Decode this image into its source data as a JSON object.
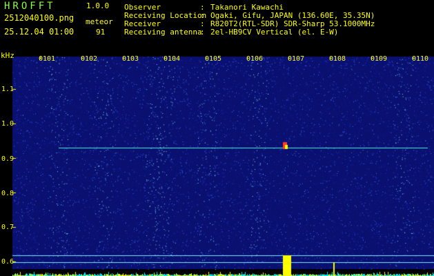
{
  "header": {
    "app_name": "HROFFT",
    "version": "1.0.0",
    "file_name": "2512040100.png",
    "datetime": "25.12.04 01:00",
    "meteor_label": "meteor",
    "meteor_count": "91",
    "info": [
      {
        "key": "Observer",
        "value": "Takanori Kawachi"
      },
      {
        "key": "Receiving Location",
        "value": "Ogaki, Gifu, JAPAN (136.60E, 35.35N)"
      },
      {
        "key": "Receiver",
        "value": "R820T2(RTL-SDR) SDR-Sharp 53.1000MHz"
      },
      {
        "key": "Receiving antenna",
        "value": "2el-HB9CV Vertical (el. E-W)"
      }
    ],
    "colon": ":"
  },
  "plot": {
    "unit": "kHz",
    "y_labels": [
      "1.1",
      "1.0",
      "0.9",
      "0.8",
      "0.7",
      "0.6"
    ],
    "x_labels": [
      "0101",
      "0102",
      "0103",
      "0104",
      "0105",
      "0106",
      "0107",
      "0108",
      "0109",
      "0110"
    ]
  },
  "colors": {
    "text": "#ffff00",
    "app_name": "#8cff3a",
    "background": "#000000",
    "noise": "#1420a0"
  }
}
